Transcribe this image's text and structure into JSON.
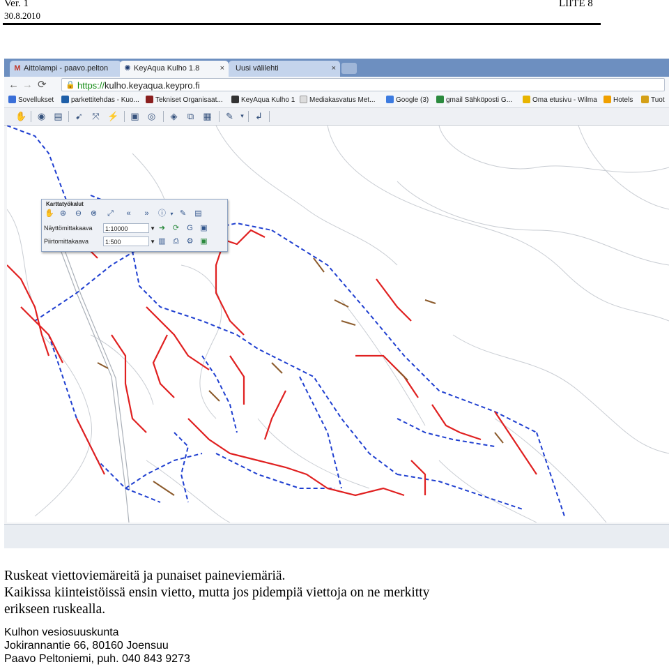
{
  "doc_header": {
    "version": "Ver. 1",
    "date": "30.8.2010",
    "appendix": "LIITE 8"
  },
  "browser": {
    "tabs": [
      {
        "label": "Aittolampi - paavo.pelton",
        "icon": "gmail-icon"
      },
      {
        "label": "KeyAqua Kulho 1.8",
        "icon": "keyaqua-icon",
        "close": "×"
      },
      {
        "label": "Uusi välilehti",
        "icon": "",
        "close": "×"
      }
    ],
    "url_scheme": "https://",
    "url_host": "kulho.keyaqua.keypro.fi",
    "bookmarks": [
      {
        "label": "Sovellukset",
        "color": "#3a6fd8"
      },
      {
        "label": "parkettitehdas - Kuo...",
        "color": "#1f5fa8"
      },
      {
        "label": "Tekniset Organisaat...",
        "color": "#8a1f1f"
      },
      {
        "label": "KeyAqua Kulho 1",
        "color": "#333333"
      },
      {
        "label": "Mediakasvatus Met...",
        "color": "#bbbbbb"
      },
      {
        "label": "Google (3)",
        "color": "#3d7be0"
      },
      {
        "label": "gmail Sähköposti G...",
        "color": "#2b8a3e"
      },
      {
        "label": "Oma etusivu - Wilma",
        "color": "#e8b400"
      },
      {
        "label": "Hotels",
        "color": "#f0a000"
      },
      {
        "label": "Tuot",
        "color": "#d4a017"
      }
    ]
  },
  "map_tools": {
    "title": "Karttatyökalut",
    "view_scale_label": "Näyttömittakaava",
    "view_scale_value": "1:10000",
    "draw_scale_label": "Piirtomittakaava",
    "draw_scale_value": "1:500"
  },
  "caption": {
    "line1": "Ruskeat viettoviemäreitä ja punaiset paineviemäriä.",
    "line2": "Kaikissa kiinteistöissä ensin vietto, mutta jos pidempiä viettoja on ne merkitty",
    "line3": "erikseen ruskealla."
  },
  "footer": {
    "org": "Kulhon vesiosuuskunta",
    "address": "Jokirannantie 66, 80160 Joensuu",
    "contact": "Paavo Peltoniemi, puh. 040 843 9273"
  },
  "colors": {
    "pressure_sewer": "#e02020",
    "gravity_sewer": "#8b5a2b",
    "water_main": "#1f3fd0",
    "tabbar": "#6d8fc0"
  }
}
